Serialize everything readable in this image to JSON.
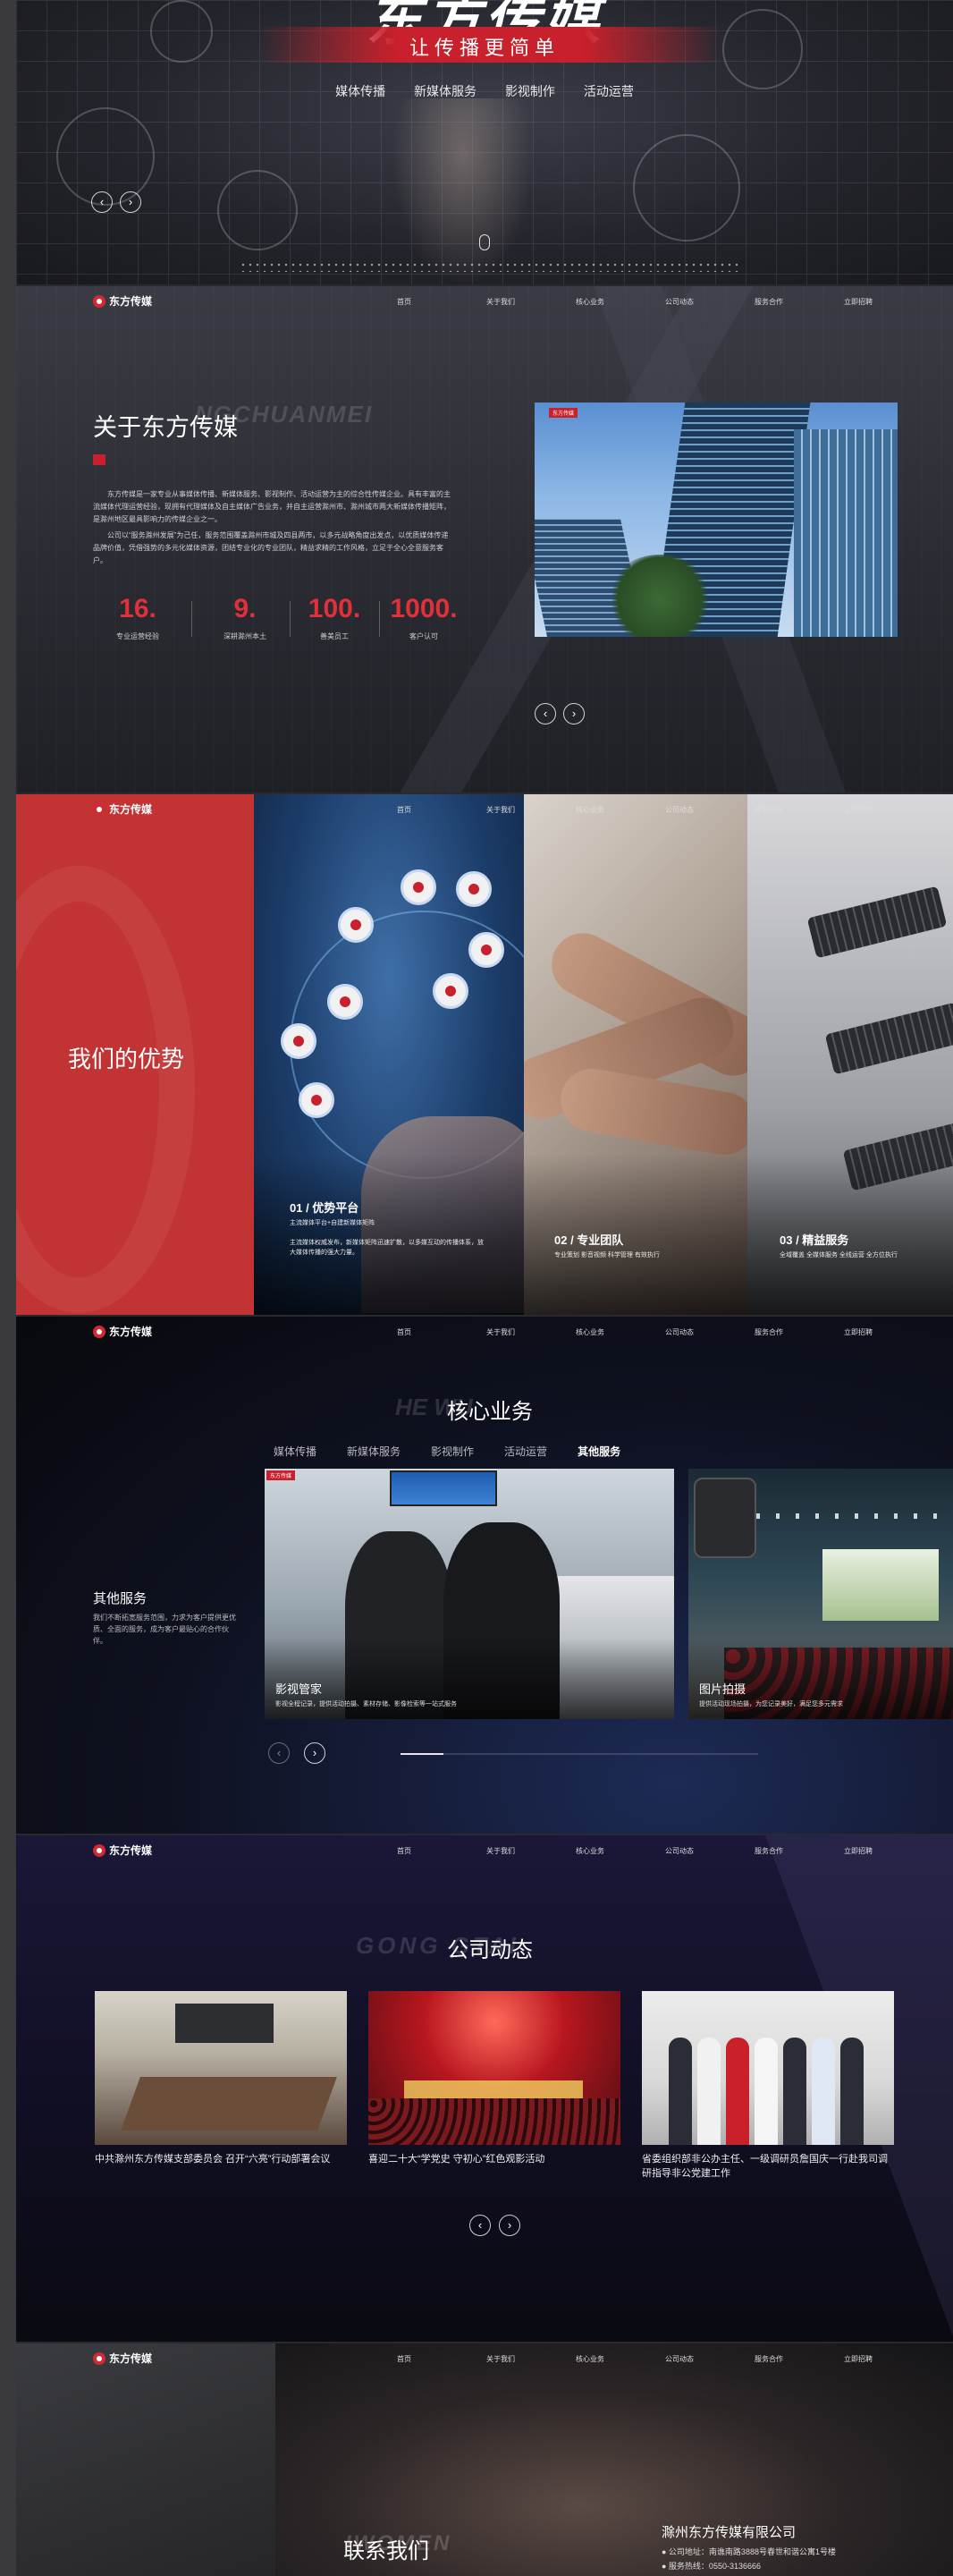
{
  "colors": {
    "brand_red": "#c8202c",
    "accent_red": "#e0303a",
    "dark_bg": "#1c1d22"
  },
  "hero": {
    "slogan": "让传播更简单",
    "nav": [
      "媒体传播",
      "新媒体服务",
      "影视制作",
      "活动运营"
    ],
    "prev_icon": "‹",
    "next_icon": "›"
  },
  "site_nav": {
    "logo_text": "东方传媒",
    "items": [
      "首页",
      "关于我们",
      "核心业务",
      "公司动态",
      "服务合作",
      "立即招聘"
    ]
  },
  "about": {
    "bg_word": "NGCHUANMEI",
    "title": "关于东方传媒",
    "photo_badge": "东方传媒",
    "paragraphs": [
      "东方传媒是一家专业从事媒体传播、新媒体服务、影视制作、活动运营为主的综合性传媒企业。具有丰富的主流媒体代理运营经验，现拥有代理媒体及自主媒体广告业务，并自主运营滁州市、滁州城市两大新媒体传播矩阵，是滁州地区最具影响力的传媒企业之一。",
      "公司以“服务滁州发展”为己任，服务范围覆盖滁州市城及四县两市，以多元战略角度出发点，以优质媒体传递品牌价值，凭借强势的多元化媒体资源，团结专业化的专业团队，精益求精的工作风格，立足于全心全意服务客户。"
    ],
    "stats": [
      {
        "value": "16",
        "label": "专业运营经验"
      },
      {
        "value": "9",
        "label": "深耕滁州本土"
      },
      {
        "value": "100",
        "label": "善美员工"
      },
      {
        "value": "1000",
        "label": "客户认可"
      }
    ],
    "stat_suffix": "."
  },
  "advantages": {
    "heading": "我们的优势",
    "cards": [
      {
        "title": "01 / 优势平台",
        "subtitle": "主流媒体平台+自建新媒体矩阵",
        "desc": "主流媒体权威发布，新媒体矩阵迅速扩散，以多媒互动的传播体系，放大媒体传播的强大力量。"
      },
      {
        "title": "02 / 专业团队",
        "desc": "专业策划 影音视频 科学管理 有效执行"
      },
      {
        "title": "03 / 精益服务",
        "desc": "全域覆盖 全媒体服务 全线运营 全方位执行"
      }
    ]
  },
  "core": {
    "bg_word": "HE WU",
    "title": "核心业务",
    "tabs": [
      "媒体传播",
      "新媒体服务",
      "影视制作",
      "活动运营",
      "其他服务"
    ],
    "active_tab": 4,
    "side_title": "其他服务",
    "side_text": "我们不断拓宽服务范围，力求为客户提供更优质、全面的服务，成为客户最贴心的合作伙伴。",
    "items": [
      {
        "title": "影视管家",
        "desc": "影视全程记录，提供活动拍摄、素材存储、影像检索等一站式服务",
        "tag": "东方传媒"
      },
      {
        "title": "图片拍摄",
        "desc": "提供活动现场拍摄，为您记录美好，满足您多元需求"
      }
    ],
    "progress": 0.12
  },
  "news": {
    "bg_word": "GONG   GTAI",
    "title": "公司动态",
    "items": [
      {
        "title": "中共滁州东方传媒支部委员会 召开“六亮”行动部署会议"
      },
      {
        "title": "喜迎二十大“学党史 守初心”红色观影活动"
      },
      {
        "title": "省委组织部非公办主任、一级调研员詹国庆一行赴我司调研指导非公党建工作"
      }
    ]
  },
  "contact": {
    "bg_word": "IWOMEN",
    "title": "联系我们",
    "company": "滁州东方传媒有限公司",
    "address": "● 公司地址：南谯南路3888号春世和谐公寓1号楼",
    "phone": "● 服务热线：0550-3136666"
  }
}
